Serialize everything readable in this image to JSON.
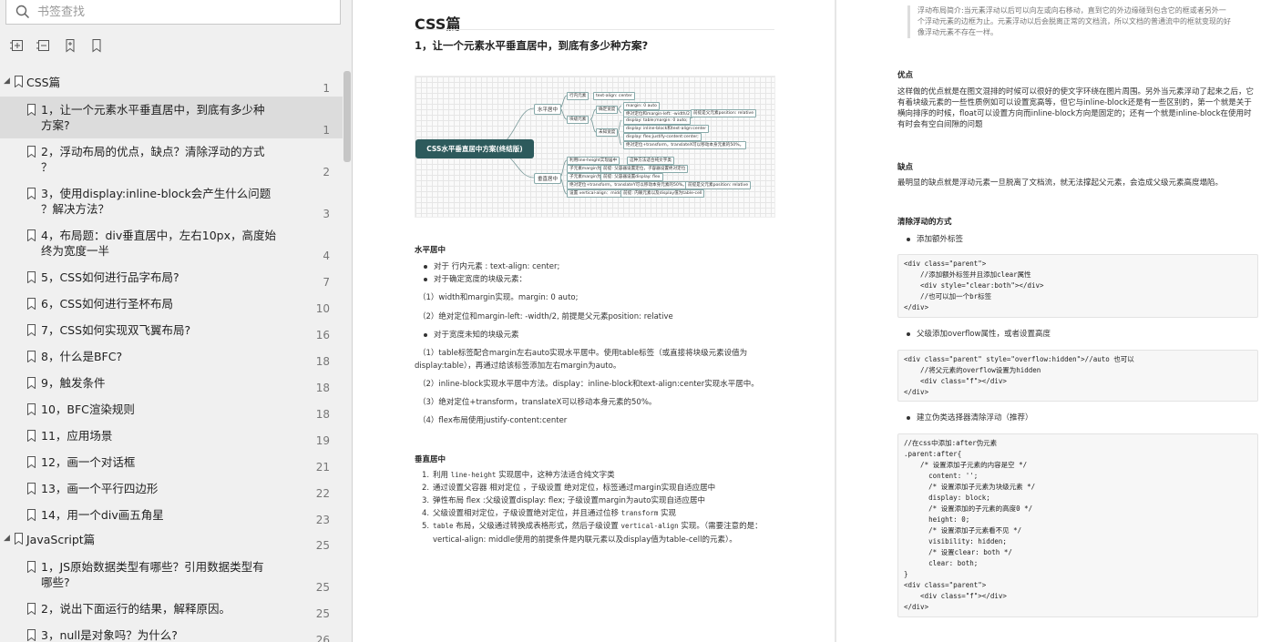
{
  "sidebar": {
    "search_placeholder": "书签查找",
    "tools": [
      "expand-all-icon",
      "collapse-all-icon",
      "add-bookmark-icon",
      "bookmark-icon"
    ],
    "items": [
      {
        "level": 0,
        "text": "CSS篇",
        "page": "1",
        "h": 28,
        "expanded": true
      },
      {
        "level": 1,
        "text": "1，让一个元素水平垂直居中，到底有多少种\n方案?",
        "page": "1",
        "h": 46,
        "selected": true
      },
      {
        "level": 1,
        "text": "2，浮动布局的优点，缺点？清除浮动的方式\n？",
        "page": "2",
        "h": 46
      },
      {
        "level": 1,
        "text": "3，使用display:inline-block会产生什么问题\n？解决方法？",
        "page": "3",
        "h": 46
      },
      {
        "level": 1,
        "text": "4，布局题：div垂直居中，左右10px，高度始\n终为宽度一半",
        "page": "4",
        "h": 46
      },
      {
        "level": 1,
        "text": "5，CSS如何进行品字布局?",
        "page": "7",
        "h": 29
      },
      {
        "level": 1,
        "text": "6，CSS如何进行圣杯布局",
        "page": "10",
        "h": 29
      },
      {
        "level": 1,
        "text": "7，CSS如何实现双飞翼布局?",
        "page": "16",
        "h": 29
      },
      {
        "level": 1,
        "text": "8，什么是BFC?",
        "page": "18",
        "h": 29
      },
      {
        "level": 1,
        "text": "9，触发条件",
        "page": "18",
        "h": 29
      },
      {
        "level": 1,
        "text": "10，BFC渲染规则",
        "page": "18",
        "h": 29
      },
      {
        "level": 1,
        "text": "11，应用场景",
        "page": "19",
        "h": 29
      },
      {
        "level": 1,
        "text": "12，画一个对话框",
        "page": "21",
        "h": 29
      },
      {
        "level": 1,
        "text": "13，画一个平行四边形",
        "page": "22",
        "h": 29
      },
      {
        "level": 1,
        "text": "14，用一个div画五角星",
        "page": "23",
        "h": 29
      },
      {
        "level": 0,
        "text": "JavaScript篇",
        "page": "25",
        "h": 28,
        "expanded": true
      },
      {
        "level": 1,
        "text": "1，JS原始数据类型有哪些？引用数据类型有\n哪些?",
        "page": "25",
        "h": 46
      },
      {
        "level": 1,
        "text": "2，说出下面运行的结果，解释原因。",
        "page": "25",
        "h": 29
      },
      {
        "level": 1,
        "text": "3，null是对象吗？为什么?",
        "page": "26",
        "h": 29
      }
    ]
  },
  "pageA": {
    "title": "CSS篇",
    "question": "1，让一个元素水平垂直居中，到底有多少种方案?",
    "mindmap": {
      "root": "CSS水平垂直居中方案(终结版)",
      "branch_h": "水平居中",
      "branch_v": "垂直居中",
      "h_nodes": [
        "行内元素",
        "text-align: center",
        "块级元素",
        "确定宽度",
        "margin: 0 auto",
        "绝对定位和margin-left: -width/2",
        "前提是父元素position: relative",
        "未知宽度",
        "display: table;margin: 0 auto;",
        "display: inline-block和text-align:center",
        "display: flex;justify-content:center;",
        "绝对定位+transform，translateX可以移动本身元素的50%。"
      ],
      "v_nodes": [
        "利用line-height实现居中",
        "这种方法适合纯文字类",
        "子元素margin为auto",
        "前提: 父容器设置定位，子容器设置绝对定位",
        "子元素margin为auto",
        "前提: 父容器设置display: flex",
        "绝对定位+transform，translateY可以移动本身元素的50%。",
        "前提是父元素position: relative",
        "设置 vertical-align：middle",
        "前提: 内联元素以及display值为table-cell"
      ]
    },
    "h_title": "水平居中",
    "h_bullets": [
      "对于 行内元素 : text-align: center;",
      "对于确定宽度的块级元素："
    ],
    "h_p1": "（1）width和margin实现。margin: 0 auto;",
    "h_p2": "（2）绝对定位和margin-left: -width/2, 前提是父元素position: relative",
    "h_bullet3": "对于宽度未知的块级元素",
    "h_p3": "（1）table标签配合margin左右auto实现水平居中。使用table标签（或直接将块级元素设值为",
    "h_p3b": "display:table），再通过给该标签添加左右margin为auto。",
    "h_p4": "（2）inline-block实现水平居中方法。display：inline-block和text-align:center实现水平居中。",
    "h_p5": "（3）绝对定位+transform，translateX可以移动本身元素的50%。",
    "h_p6": "（4）flex布局使用justify-content:center",
    "v_title": "垂直居中",
    "v_items": [
      {
        "n": "1.",
        "a": "利用 ",
        "code": "line-height",
        "b": " 实现居中，这种方法适合纯文字类"
      },
      {
        "n": "2.",
        "a": "通过设置父容器 相对定位 ，子级设置 绝对定位，标签通过margin实现自适应居中",
        "code": "",
        "b": ""
      },
      {
        "n": "3.",
        "a": "弹性布局 flex :父级设置display: flex; 子级设置margin为auto实现自适应居中",
        "code": "",
        "b": ""
      },
      {
        "n": "4.",
        "a": "父级设置相对定位，子级设置绝对定位，并且通过位移 ",
        "code": "transform",
        "b": " 实现"
      },
      {
        "n": "5.",
        "a": "",
        "code": "table",
        "b": " 布局，父级通过转换成表格形式，然后子级设置 "
      }
    ],
    "v5_code2": "vertical-align",
    "v5_tail": " 实现。（需要注意的是：",
    "v5_line2": "vertical-align: middle使用的前提条件是内联元素以及display值为table-cell的元素）。"
  },
  "pageB": {
    "quote": "浮动布局简介:当元素浮动以后可以向左或向右移动，直到它的外边缘碰到包含它的框或者另外一个浮动元素的边框为止。元素浮动以后会脱离正常的文档流，所以文档的普通流中的框就变现的好像浮动元素不存在一样。",
    "adv_title": "优点",
    "adv_text": "这样做的优点就是在图文混排的时候可以很好的使文字环绕在图片周围。另外当元素浮动了起来之后，它有着块级元素的一些性质例如可以设置宽高等，但它与inline-block还是有一些区别的，第一个就是关于横向排序的时候，float可以设置方向而inline-block方向是固定的；还有一个就是inline-block在使用时有时会有空白间隙的问题",
    "dis_title": "缺点",
    "dis_text": "最明显的缺点就是浮动元素一旦脱离了文档流，就无法撑起父元素，会造成父级元素高度塌陷。",
    "clear_title": "清除浮动的方式",
    "b1": "添加额外标签",
    "code1": "<div class=\"parent\">\n    //添加额外标签并且添加clear属性\n    <div style=\"clear:both\"></div>\n    //也可以加一个br标签\n</div>",
    "b2": "父级添加overflow属性，或者设置高度",
    "code2": "<div class=\"parent\" style=\"overflow:hidden\">//auto 也可以\n    //将父元素的overflow设置为hidden\n    <div class=\"f\"></div>\n</div>",
    "b3": "建立伪类选择器清除浮动（推荐）",
    "code3": "//在css中添加:after伪元素\n.parent:after{\n    /* 设置添加子元素的内容是空 */\n      content: '';\n      /* 设置添加子元素为块级元素 */\n      display: block;\n      /* 设置添加的子元素的高度0 */\n      height: 0;\n      /* 设置添加子元素看不见 */\n      visibility: hidden;\n      /* 设置clear: both */\n      clear: both;\n}\n<div class=\"parent\">\n    <div class=\"f\"></div>\n</div>"
  }
}
